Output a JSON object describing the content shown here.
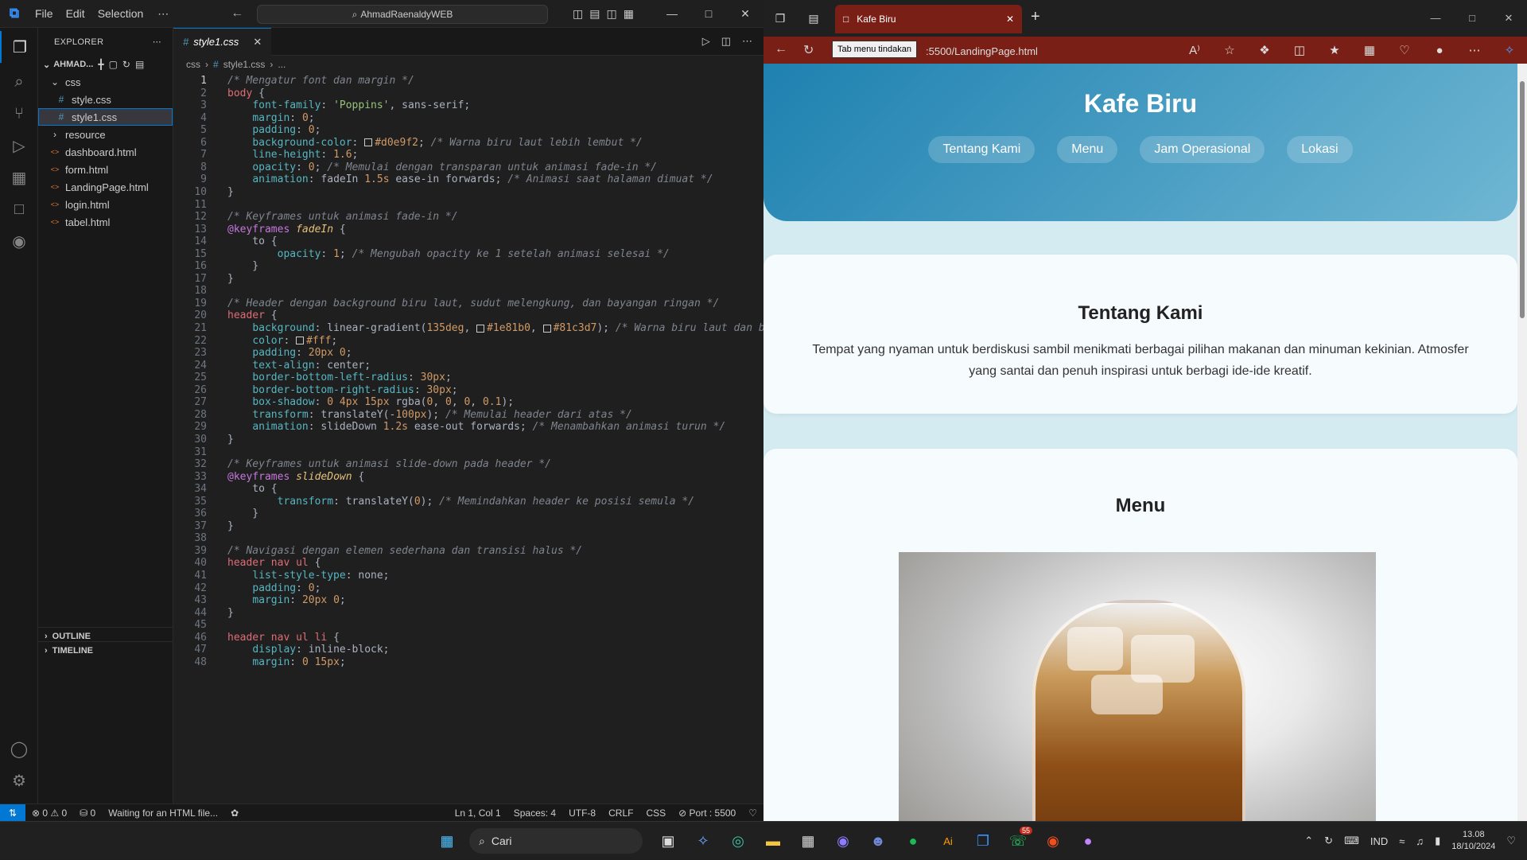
{
  "vscode": {
    "menus": [
      "File",
      "Edit",
      "Selection"
    ],
    "more": "⋯",
    "search": "AhmadRaenaldyWEB",
    "explorer_title": "EXPLORER",
    "project": "AHMAD...",
    "tree": [
      {
        "name": "css",
        "type": "folder",
        "indent": 0,
        "open": true
      },
      {
        "name": "style.css",
        "type": "css",
        "indent": 1
      },
      {
        "name": "style1.css",
        "type": "css",
        "indent": 1,
        "selected": true
      },
      {
        "name": "resource",
        "type": "folder",
        "indent": 0,
        "open": false
      },
      {
        "name": "dashboard.html",
        "type": "html",
        "indent": 0
      },
      {
        "name": "form.html",
        "type": "html",
        "indent": 0
      },
      {
        "name": "LandingPage.html",
        "type": "html",
        "indent": 0
      },
      {
        "name": "login.html",
        "type": "html",
        "indent": 0
      },
      {
        "name": "tabel.html",
        "type": "html",
        "indent": 0
      }
    ],
    "outline": "OUTLINE",
    "timeline": "TIMELINE",
    "tab": "style1.css",
    "breadcrumb": [
      "css",
      "style1.css",
      "..."
    ],
    "code_lines": [
      "/* Mengatur font dan margin */",
      "body {",
      "    font-family: 'Poppins', sans-serif;",
      "    margin: 0;",
      "    padding: 0;",
      "    background-color: #d0e9f2; /* Warna biru laut lebih lembut */",
      "    line-height: 1.6;",
      "    opacity: 0; /* Memulai dengan transparan untuk animasi fade-in */",
      "    animation: fadeIn 1.5s ease-in forwards; /* Animasi saat halaman dimuat */",
      "}",
      "",
      "/* Keyframes untuk animasi fade-in */",
      "@keyframes fadeIn {",
      "    to {",
      "        opacity: 1; /* Mengubah opacity ke 1 setelah animasi selesai */",
      "    }",
      "}",
      "",
      "/* Header dengan background biru laut, sudut melengkung, dan bayangan ringan */",
      "header {",
      "    background: linear-gradient(135deg, #1e81b0, #81c3d7); /* Warna biru laut dan b",
      "    color: #fff;",
      "    padding: 20px 0;",
      "    text-align: center;",
      "    border-bottom-left-radius: 30px;",
      "    border-bottom-right-radius: 30px;",
      "    box-shadow: 0 4px 15px rgba(0, 0, 0, 0.1);",
      "    transform: translateY(-100px); /* Memulai header dari atas */",
      "    animation: slideDown 1.2s ease-out forwards; /* Menambahkan animasi turun */",
      "}",
      "",
      "/* Keyframes untuk animasi slide-down pada header */",
      "@keyframes slideDown {",
      "    to {",
      "        transform: translateY(0); /* Memindahkan header ke posisi semula */",
      "    }",
      "}",
      "",
      "/* Navigasi dengan elemen sederhana dan transisi halus */",
      "header nav ul {",
      "    list-style-type: none;",
      "    padding: 0;",
      "    margin: 20px 0;",
      "}",
      "",
      "header nav ul li {",
      "    display: inline-block;",
      "    margin: 0 15px;"
    ],
    "status": {
      "errors": "⊗ 0 ⚠ 0",
      "ports": "⛁ 0",
      "message": "Waiting for an HTML file...",
      "position": "Ln 1, Col 1",
      "spaces": "Spaces: 4",
      "encoding": "UTF-8",
      "eol": "CRLF",
      "language": "CSS",
      "port": "⊘ Port : 5500"
    }
  },
  "browser": {
    "tab_title": "Kafe Biru",
    "tooltip": "Tab menu tindakan",
    "url": ":5500/LandingPage.html",
    "page": {
      "title": "Kafe Biru",
      "nav": [
        "Tentang Kami",
        "Menu",
        "Jam Operasional",
        "Lokasi"
      ],
      "about_title": "Tentang Kami",
      "about_text": "Tempat yang nyaman untuk berdiskusi sambil menikmati berbagai pilihan makanan dan minuman kekinian. Atmosfer yang santai dan penuh inspirasi untuk berbagi ide-ide kreatif.",
      "menu_title": "Menu"
    },
    "colors": {
      "header_start": "#1e81b0",
      "header_end": "#81c3d7",
      "body": "#d0e9f2",
      "tab": "#7a1f16"
    }
  },
  "taskbar": {
    "search": "Cari",
    "lang": "IND",
    "time": "13.08",
    "date": "18/10/2024",
    "whatsapp_badge": "55"
  }
}
